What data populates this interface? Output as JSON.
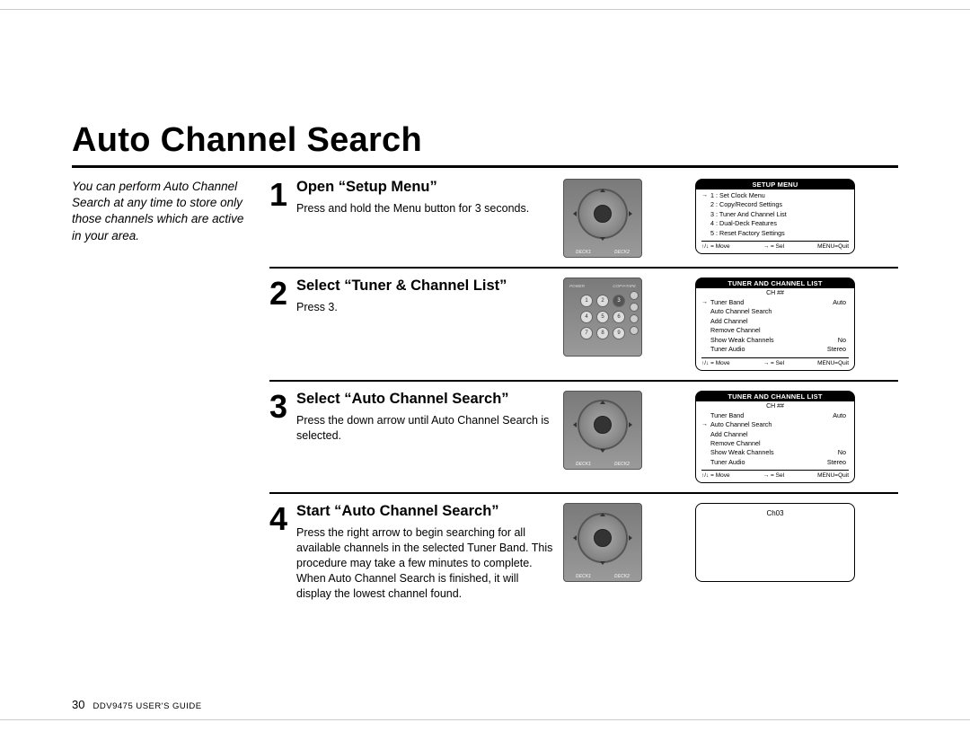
{
  "page": {
    "title": "Auto Channel Search",
    "page_number": "30",
    "doc_id": "DDV9475 USER'S GUIDE"
  },
  "sidebar_note": "You can perform Auto Channel Search at any time to store only those channels which are active in your area.",
  "steps": [
    {
      "num": "1",
      "title": "Open “Setup Menu”",
      "desc": "Press and hold the Menu button for 3 seconds.",
      "remote_type": "dpad",
      "remote_deck_left": "DECK1",
      "remote_deck_right": "DECK2",
      "osd": {
        "header": "SETUP MENU",
        "sub": "",
        "rows": [
          {
            "left": "1 :",
            "label": "Set Clock Menu",
            "right": "",
            "sel": true
          },
          {
            "left": "2 :",
            "label": "Copy/Record Settings",
            "right": ""
          },
          {
            "left": "3 :",
            "label": "Tuner And Channel List",
            "right": ""
          },
          {
            "left": "4 :",
            "label": "Dual-Deck Features",
            "right": ""
          },
          {
            "left": "5 :",
            "label": "Reset Factory Settings",
            "right": ""
          }
        ],
        "footer": {
          "left": "↑/↓ = Move",
          "mid": "→ = Sel",
          "right": "MENU=Quit"
        }
      }
    },
    {
      "num": "2",
      "title": "Select “Tuner & Channel List”",
      "desc": "Press 3.",
      "remote_type": "numpad",
      "remote_highlight": "3",
      "osd": {
        "header": "TUNER AND CHANNEL LIST",
        "sub": "CH ##",
        "rows": [
          {
            "label": "Tuner Band",
            "right": "Auto",
            "sel": true
          },
          {
            "label": "Auto Channel Search",
            "right": ""
          },
          {
            "label": "Add Channel",
            "right": ""
          },
          {
            "label": "Remove Channel",
            "right": ""
          },
          {
            "label": "Show Weak Channels",
            "right": "No"
          },
          {
            "label": "Tuner Audio",
            "right": "Stereo"
          }
        ],
        "footer": {
          "left": "↑/↓ = Move",
          "mid": "→ = Sel",
          "right": "MENU=Quit"
        }
      }
    },
    {
      "num": "3",
      "title": "Select “Auto Channel Search”",
      "desc": "Press the down arrow until Auto Channel Search is selected.",
      "remote_type": "dpad",
      "remote_deck_left": "DECK1",
      "remote_deck_right": "DECK2",
      "osd": {
        "header": "TUNER AND CHANNEL LIST",
        "sub": "CH ##",
        "rows": [
          {
            "label": "Tuner Band",
            "right": "Auto"
          },
          {
            "label": "Auto Channel Search",
            "right": "",
            "sel": true
          },
          {
            "label": "Add Channel",
            "right": ""
          },
          {
            "label": "Remove Channel",
            "right": ""
          },
          {
            "label": "Show Weak Channels",
            "right": "No"
          },
          {
            "label": "Tuner Audio",
            "right": "Stereo"
          }
        ],
        "footer": {
          "left": "↑/↓ = Move",
          "mid": "→ = Sel",
          "right": "MENU=Quit"
        }
      }
    },
    {
      "num": "4",
      "title": "Start “Auto Channel Search”",
      "desc": "Press the right arrow to begin searching for all available channels in the selected Tuner Band. This procedure may take a few minutes to complete. When Auto Channel Search is finished, it will display the lowest channel found.",
      "remote_type": "dpad",
      "remote_deck_left": "DECK1",
      "remote_deck_right": "DECK2",
      "osd": {
        "small_label": "Ch03"
      }
    }
  ]
}
